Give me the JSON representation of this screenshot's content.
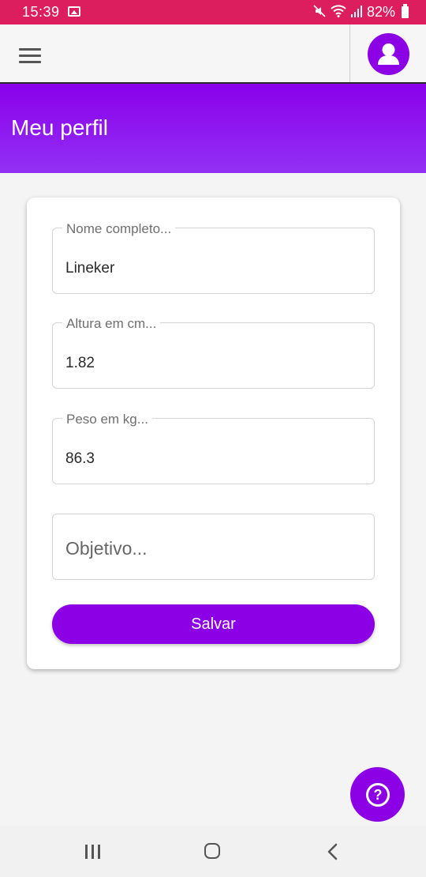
{
  "status_bar": {
    "time": "15:39",
    "battery_percent": "82%",
    "icons": [
      "gallery-icon",
      "mute-icon",
      "wifi-icon",
      "signal-icon",
      "battery-icon"
    ]
  },
  "app_bar": {
    "icons": [
      "menu-icon",
      "user-avatar-icon"
    ]
  },
  "header": {
    "title": "Meu perfil"
  },
  "form": {
    "name": {
      "label": "Nome completo...",
      "value": "Lineker"
    },
    "height": {
      "label": "Altura em cm...",
      "value": "1.82"
    },
    "weight": {
      "label": "Peso em kg...",
      "value": "86.3"
    },
    "goal": {
      "placeholder": "Objetivo...",
      "value": ""
    },
    "save_label": "Salvar"
  },
  "help_fab": {
    "glyph": "?"
  },
  "colors": {
    "status_bar": "#dc1d5e",
    "accent": "#8c00e6",
    "header_gradient_start": "#8a00ea",
    "header_gradient_end": "#9230f4",
    "background": "#f4f4f4"
  },
  "nav_bar": {
    "icons": [
      "recents-icon",
      "home-icon",
      "back-icon"
    ]
  }
}
